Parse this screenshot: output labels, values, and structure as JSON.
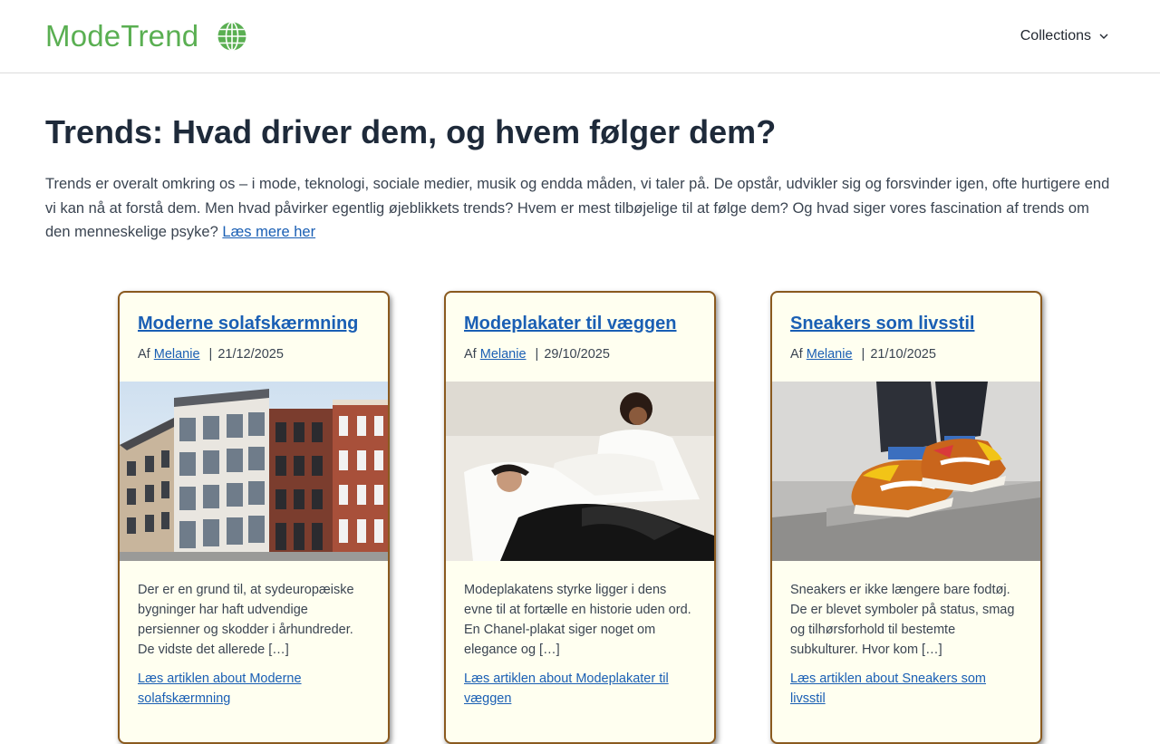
{
  "header": {
    "logo_part1": "Mode",
    "logo_part2": "Trend",
    "logo_icon": "globe-icon",
    "nav_collections": "Collections",
    "nav_icon": "chevron-down-icon"
  },
  "main": {
    "title": "Trends: Hvad driver dem, og hvem følger dem?",
    "intro": "Trends er overalt omkring os – i mode, teknologi, sociale medier, musik og endda måden, vi taler på. De opstår, udvikler sig og forsvinder igen, ofte hurtigere end vi kan nå at forstå dem. Men hvad påvirker egentlig øjeblikkets trends? Hvem er mest tilbøjelige til at følge dem? Og hvad siger vores fascination af trends om den menneskelige psyke?",
    "intro_link": "Læs mere her"
  },
  "cards": [
    {
      "title": "Moderne solafskærmning",
      "by": "Af",
      "author": "Melanie",
      "separator": "|",
      "date": "21/12/2025",
      "excerpt": "Der er en grund til, at sydeuropæiske bygninger har haft udvendige persienner og skodder i århundreder. De vidste det allerede […]",
      "link": "Læs artiklen about Moderne solafskærmning"
    },
    {
      "title": "Modeplakater til væggen",
      "by": "Af",
      "author": "Melanie",
      "separator": "|",
      "date": "29/10/2025",
      "excerpt": "Modeplakatens styrke ligger i dens evne til at fortælle en historie uden ord. En Chanel-plakat siger noget om elegance og […]",
      "link": "Læs artiklen about Modeplakater til væggen"
    },
    {
      "title": "Sneakers som livsstil",
      "by": "Af",
      "author": "Melanie",
      "separator": "|",
      "date": "21/10/2025",
      "excerpt": "Sneakers er ikke længere bare fodtøj. De er blevet symboler på status, smag og tilhørsforhold til bestemte subkulturer. Hvor kom […]",
      "link": "Læs artiklen about Sneakers som livsstil"
    }
  ],
  "colors": {
    "brand_green": "#5aaf52",
    "link_blue": "#1a5fb4",
    "card_border": "#8a5a1f",
    "card_bg": "#fffff0"
  }
}
